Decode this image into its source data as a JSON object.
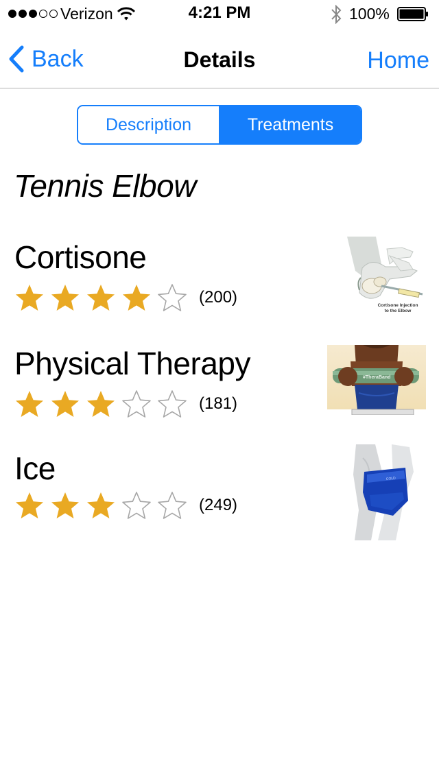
{
  "status_bar": {
    "carrier": "Verizon",
    "time": "4:21 PM",
    "battery": "100%",
    "signal_filled": 3,
    "signal_total": 5
  },
  "nav": {
    "back_label": "Back",
    "title": "Details",
    "home_label": "Home"
  },
  "tabs": {
    "description": "Description",
    "treatments": "Treatments",
    "selected": "Treatments"
  },
  "condition": "Tennis Elbow",
  "treatments": [
    {
      "name": "Cortisone",
      "rating": 4,
      "max_rating": 5,
      "reviews": "(200)",
      "image_caption_line1": "Cortisone Injection",
      "image_caption_line2": "to the Elbow",
      "image_icon": "elbow-injection-illustration"
    },
    {
      "name": "Physical Therapy",
      "rating": 3,
      "max_rating": 5,
      "reviews": "(181)",
      "image_icon": "therapy-bar-photo"
    },
    {
      "name": "Ice",
      "rating": 3,
      "max_rating": 5,
      "reviews": "(249)",
      "image_icon": "ice-wrap-photo"
    }
  ],
  "colors": {
    "accent": "#157efb",
    "star_filled": "#e9a923",
    "star_empty": "#a6a6a6"
  }
}
